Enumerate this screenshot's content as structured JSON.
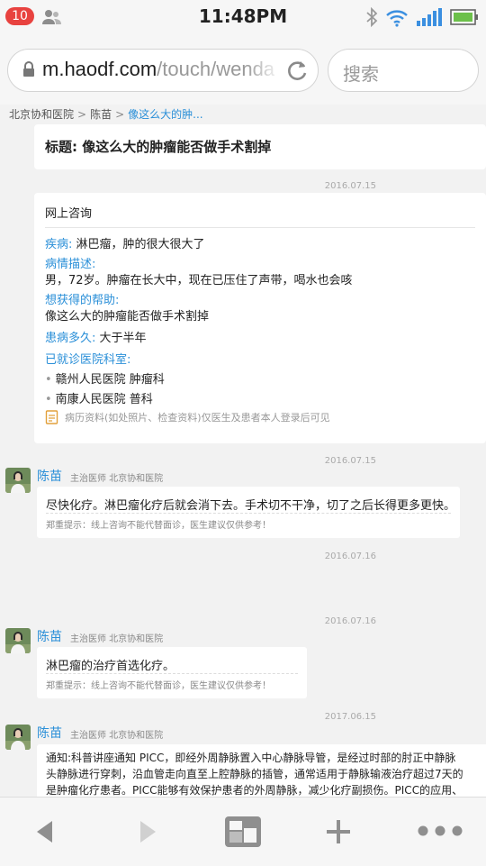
{
  "status_bar": {
    "notification_count": "10",
    "time": "11:48PM"
  },
  "browser": {
    "url_host": "m.haodf.com",
    "url_path": "/touch/wenda",
    "search_placeholder": "搜索"
  },
  "breadcrumb": [
    "北京协和医院",
    "陈苗",
    "像这么大的肿..."
  ],
  "breadcrumb_sep": ">",
  "question": {
    "title": "标题: 像这么大的肿瘤能否做手术割掉",
    "date": "2016.07.15"
  },
  "consult": {
    "header": "网上咨询",
    "disease_label": "疾病:",
    "disease_value": " 淋巴瘤，肿的很大很大了",
    "desc_label": "病情描述:",
    "desc_value": "男，72岁。肿瘤在长大中，现在已压住了声带，喝水也会咳",
    "help_label": "想获得的帮助:",
    "help_value": "像这么大的肿瘤能否做手术割掉",
    "duration_label": "患病多久:",
    "duration_value": " 大于半年",
    "hospital_label": "已就诊医院科室:",
    "hospitals": [
      "赣州人民医院 肿瘤科",
      "南康人民医院 普科"
    ],
    "records_note": "病历资料(如处照片、检查资料)仅医生及患者本人登录后可见"
  },
  "doctor": {
    "name": "陈苗",
    "title": "主治医师 北京协和医院"
  },
  "replies": [
    {
      "date": "2016.07.15",
      "text": "尽快化疗。淋巴瘤化疗后就会消下去。手术切不干净，切了之后长得更多更快。",
      "tip": "郑重提示：线上咨询不能代替面诊，医生建议仅供参考！"
    },
    {
      "date": "2016.07.16",
      "text": "淋巴瘤的治疗首选化疗。",
      "tip": "郑重提示：线上咨询不能代替面诊，医生建议仅供参考！"
    },
    {
      "date": "2017.06.15",
      "lines": [
        "通知:科普讲座通知 PICC，即经外周静脉置入中心静脉导管，是经过时部的肘正中静脉",
        "头静脉进行穿刺，沿血管走向直至上腔静脉的插管，通常适用于静脉输液治疗超过7天的",
        "是肿瘤化疗患者。PICC能够有效保护患者的外周静脉，减少化疗副损伤。PICC的应用、"
      ]
    }
  ],
  "empty_date": "2016.07.16",
  "colors": {
    "accent": "#2a8fd8",
    "badge": "#e8423f",
    "battery": "#6cc04a",
    "signal": "#3b8fe0"
  },
  "toolbar_icons": [
    "back-icon",
    "forward-icon",
    "tabs-icon",
    "plus-icon",
    "more-icon"
  ]
}
